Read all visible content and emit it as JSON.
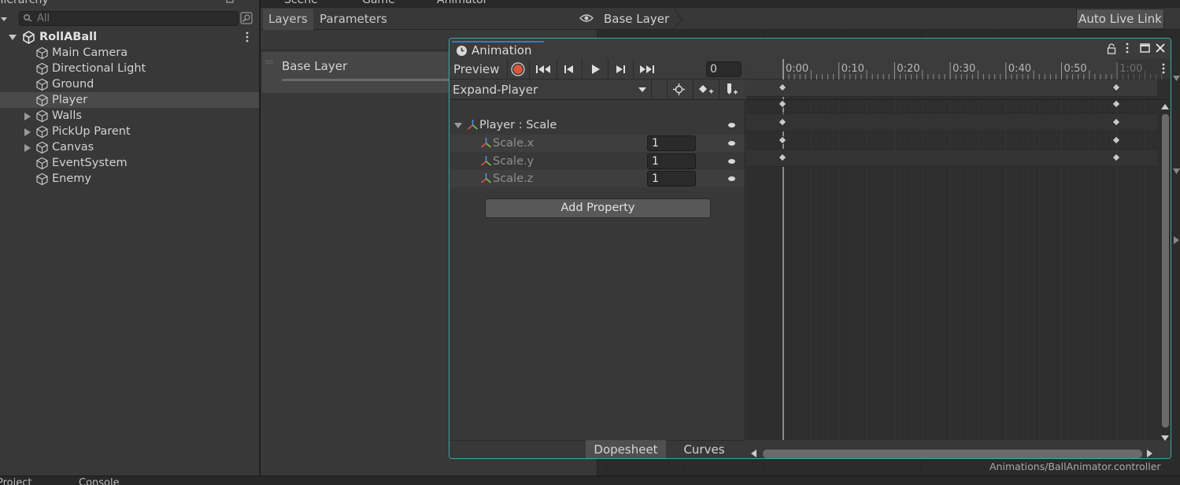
{
  "hierarchy": {
    "tab_label": "Hierarchy",
    "search_placeholder": "All",
    "scene_name": "RollABall",
    "items": [
      {
        "label": "Main Camera",
        "expandable": false,
        "selected": false
      },
      {
        "label": "Directional Light",
        "expandable": false,
        "selected": false
      },
      {
        "label": "Ground",
        "expandable": false,
        "selected": false
      },
      {
        "label": "Player",
        "expandable": false,
        "selected": true
      },
      {
        "label": "Walls",
        "expandable": true,
        "selected": false
      },
      {
        "label": "PickUp Parent",
        "expandable": true,
        "selected": false
      },
      {
        "label": "Canvas",
        "expandable": true,
        "selected": false
      },
      {
        "label": "EventSystem",
        "expandable": false,
        "selected": false
      },
      {
        "label": "Enemy",
        "expandable": false,
        "selected": false
      }
    ]
  },
  "top_tabs": [
    "Scene",
    "Game",
    "Animator"
  ],
  "animator": {
    "tab_layers": "Layers",
    "tab_parameters": "Parameters",
    "layer_name": "Base Layer",
    "breadcrumb": "Base Layer",
    "auto_live_link": "Auto Live Link",
    "footer_path": "Animations/BallAnimator.controller"
  },
  "animation": {
    "title": "Animation",
    "preview_label": "Preview",
    "frame_value": "0",
    "clip_name": "Expand-Player",
    "group_label": "Player : Scale",
    "properties": [
      {
        "name": "Scale.x",
        "value": "1"
      },
      {
        "name": "Scale.y",
        "value": "1"
      },
      {
        "name": "Scale.z",
        "value": "1"
      }
    ],
    "add_property": "Add Property",
    "view_tabs": [
      "Dopesheet",
      "Curves"
    ],
    "timeline_labels": [
      "0:00",
      "0:10",
      "0:20",
      "0:30",
      "0:40",
      "0:50",
      "1:00"
    ],
    "keyframe_times": [
      "0:00",
      "1:00"
    ]
  },
  "bottom_tabs": [
    "Project",
    "Console"
  ],
  "colors": {
    "accent_record": "#e0553a",
    "window_border": "#3ea7a0",
    "selection": "#4a4a4a"
  }
}
